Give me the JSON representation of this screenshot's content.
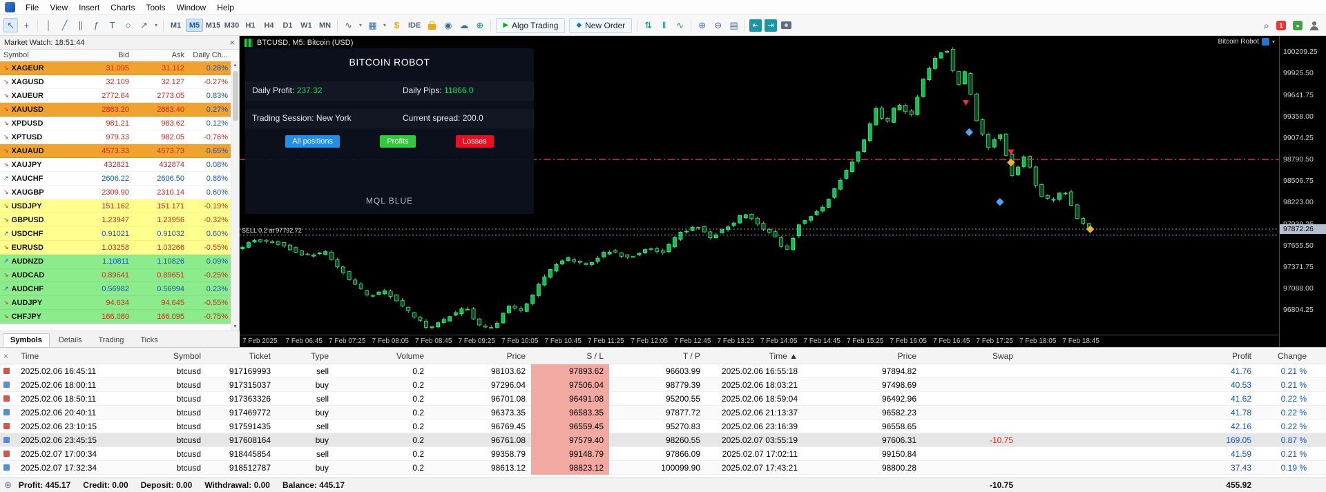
{
  "menu": {
    "items": [
      "File",
      "View",
      "Insert",
      "Charts",
      "Tools",
      "Window",
      "Help"
    ]
  },
  "toolbar": {
    "timeframes": [
      "M1",
      "M5",
      "M15",
      "M30",
      "H1",
      "H4",
      "D1",
      "W1",
      "MN"
    ],
    "active_timeframe": "M5",
    "algo_trading": "Algo Trading",
    "new_order": "New Order",
    "ide": "IDE",
    "notification_count": "1"
  },
  "icons": {
    "close": "×",
    "dropdown": "▾",
    "scroll_up": "▲",
    "scroll_down": "▼",
    "sort_asc": "▲",
    "pointer": "↖",
    "crosshair": "+",
    "vline": "│",
    "trendline": "╱",
    "channel": "∥",
    "fibonacci": "ƒ",
    "text_tool": "T",
    "shapes": "○",
    "arrow_tool": "↗",
    "indicators": "∿",
    "template": "▦",
    "dollar": "$",
    "signal": "◉",
    "cloud": "☁",
    "community": "⊕",
    "play": "▶",
    "order_plus": "◆",
    "sort": "⇅",
    "pause": "‖",
    "wave": "∿",
    "zoom_in": "⊕",
    "zoom_out": "⊖",
    "grid": "▤",
    "dock_left": "⇤",
    "dock_right": "⇥",
    "search": "⌕",
    "status_globe": "⊕",
    "vps_check": "●"
  },
  "market_watch": {
    "title": "Market Watch: 18:51:44",
    "columns": [
      "Symbol",
      "Bid",
      "Ask",
      "Daily Ch..."
    ],
    "tabs": [
      "Symbols",
      "Details",
      "Trading",
      "Ticks"
    ],
    "active_tab": "Symbols",
    "rows": [
      {
        "symbol": "XAGEUR",
        "bid": "31.095",
        "ask": "31.112",
        "change": "0.28%",
        "bg": "orange",
        "tick": "down"
      },
      {
        "symbol": "XAGUSD",
        "bid": "32.109",
        "ask": "32.127",
        "change": "-0.27%",
        "bg": "none",
        "tick": "down"
      },
      {
        "symbol": "XAUEUR",
        "bid": "2772.64",
        "ask": "2773.05",
        "change": "0.83%",
        "bg": "none",
        "tick": "down"
      },
      {
        "symbol": "XAUUSD",
        "bid": "2863.20",
        "ask": "2863.40",
        "change": "0.27%",
        "bg": "orange",
        "tick": "down"
      },
      {
        "symbol": "XPDUSD",
        "bid": "981.21",
        "ask": "983.62",
        "change": "0.12%",
        "bg": "none",
        "tick": "down"
      },
      {
        "symbol": "XPTUSD",
        "bid": "979.33",
        "ask": "982.05",
        "change": "-0.76%",
        "bg": "none",
        "tick": "down"
      },
      {
        "symbol": "XAUAUD",
        "bid": "4573.33",
        "ask": "4573.73",
        "change": "0.65%",
        "bg": "orange",
        "tick": "down"
      },
      {
        "symbol": "XAUJPY",
        "bid": "432821",
        "ask": "432874",
        "change": "0.08%",
        "bg": "none",
        "tick": "down"
      },
      {
        "symbol": "XAUCHF",
        "bid": "2606.22",
        "ask": "2606.50",
        "change": "0.88%",
        "bg": "none",
        "tick": "up"
      },
      {
        "symbol": "XAUGBP",
        "bid": "2309.90",
        "ask": "2310.14",
        "change": "0.60%",
        "bg": "none",
        "tick": "down"
      },
      {
        "symbol": "USDJPY",
        "bid": "151.162",
        "ask": "151.171",
        "change": "-0.19%",
        "bg": "yellow",
        "tick": "down"
      },
      {
        "symbol": "GBPUSD",
        "bid": "1.23947",
        "ask": "1.23956",
        "change": "-0.32%",
        "bg": "yellow",
        "tick": "down"
      },
      {
        "symbol": "USDCHF",
        "bid": "0.91021",
        "ask": "0.91032",
        "change": "0.60%",
        "bg": "yellow",
        "tick": "up"
      },
      {
        "symbol": "EURUSD",
        "bid": "1.03258",
        "ask": "1.03266",
        "change": "-0.55%",
        "bg": "yellow",
        "tick": "down"
      },
      {
        "symbol": "AUDNZD",
        "bid": "1.10811",
        "ask": "1.10826",
        "change": "0.09%",
        "bg": "green",
        "tick": "up"
      },
      {
        "symbol": "AUDCAD",
        "bid": "0.89641",
        "ask": "0.89651",
        "change": "-0.25%",
        "bg": "green",
        "tick": "down"
      },
      {
        "symbol": "AUDCHF",
        "bid": "0.56982",
        "ask": "0.56994",
        "change": "0.23%",
        "bg": "green",
        "tick": "up"
      },
      {
        "symbol": "AUDJPY",
        "bid": "94.634",
        "ask": "94.645",
        "change": "-0.55%",
        "bg": "green",
        "tick": "down"
      },
      {
        "symbol": "CHFJPY",
        "bid": "166.080",
        "ask": "166.095",
        "change": "-0.75%",
        "bg": "green",
        "tick": "down"
      }
    ]
  },
  "chart": {
    "title": "BTCUSD, M5: Bitcoin (USD)",
    "ea_label": "Bitcoin Robot",
    "sell_label": "SELL 0.2 at 97792.72",
    "current_price": "97872.26"
  },
  "robot_panel": {
    "title": "BITCOIN ROBOT",
    "daily_profit_label": "Daily Profit:",
    "daily_profit_value": "237.32",
    "daily_pips_label": "Daily Pips:",
    "daily_pips_value": "11866.0",
    "session_text": "Trading Session: New York",
    "spread_text": "Current spread: 200.0",
    "buttons": [
      {
        "label": "All positions",
        "color": "#1f8fe8"
      },
      {
        "label": "Profits",
        "color": "#2ecc3a"
      },
      {
        "label": "Losses",
        "color": "#e81123"
      }
    ],
    "footer": "MQL BLUE"
  },
  "chart_data": {
    "type": "candlestick",
    "symbol": "BTCUSD",
    "timeframe": "M5",
    "ylim": [
      96480,
      100420
    ],
    "candles": 144,
    "data_width_frac": 0.82,
    "y_ticks": [
      "100209.25",
      "99925.50",
      "99641.75",
      "99358.00",
      "99074.25",
      "98790.50",
      "98506.75",
      "98223.00",
      "97939.25",
      "97655.50",
      "97371.75",
      "97088.00",
      "96804.25"
    ],
    "x_labels": [
      "7 Feb 2025",
      "7 Feb 06:45",
      "7 Feb 07:25",
      "7 Feb 08:05",
      "7 Feb 08:45",
      "7 Feb 09:25",
      "7 Feb 10:05",
      "7 Feb 10:45",
      "7 Feb 11:25",
      "7 Feb 12:05",
      "7 Feb 12:45",
      "7 Feb 13:25",
      "7 Feb 14:05",
      "7 Feb 14:45",
      "7 Feb 15:25",
      "7 Feb 16:05",
      "7 Feb 16:45",
      "7 Feb 17:25",
      "7 Feb 18:05",
      "7 Feb 18:45"
    ],
    "current_price": 97872.26,
    "price_path": [
      [
        0,
        97600
      ],
      [
        0.02,
        97730
      ],
      [
        0.05,
        97680
      ],
      [
        0.08,
        97520
      ],
      [
        0.105,
        97560
      ],
      [
        0.13,
        97230
      ],
      [
        0.155,
        96980
      ],
      [
        0.175,
        97060
      ],
      [
        0.2,
        96800
      ],
      [
        0.225,
        96560
      ],
      [
        0.25,
        96720
      ],
      [
        0.268,
        96850
      ],
      [
        0.285,
        96590
      ],
      [
        0.302,
        96570
      ],
      [
        0.318,
        96860
      ],
      [
        0.335,
        96790
      ],
      [
        0.36,
        97240
      ],
      [
        0.385,
        97500
      ],
      [
        0.41,
        97390
      ],
      [
        0.435,
        97590
      ],
      [
        0.46,
        97490
      ],
      [
        0.48,
        97620
      ],
      [
        0.5,
        97560
      ],
      [
        0.52,
        97830
      ],
      [
        0.54,
        97910
      ],
      [
        0.555,
        97760
      ],
      [
        0.575,
        97890
      ],
      [
        0.595,
        98080
      ],
      [
        0.61,
        97950
      ],
      [
        0.63,
        97790
      ],
      [
        0.645,
        97570
      ],
      [
        0.66,
        97950
      ],
      [
        0.675,
        98060
      ],
      [
        0.69,
        98190
      ],
      [
        0.705,
        98480
      ],
      [
        0.72,
        98720
      ],
      [
        0.735,
        99010
      ],
      [
        0.75,
        99460
      ],
      [
        0.762,
        99240
      ],
      [
        0.775,
        99560
      ],
      [
        0.79,
        99340
      ],
      [
        0.805,
        99830
      ],
      [
        0.822,
        100190
      ],
      [
        0.835,
        100240
      ],
      [
        0.845,
        99720
      ],
      [
        0.855,
        99960
      ],
      [
        0.868,
        99320
      ],
      [
        0.882,
        98940
      ],
      [
        0.895,
        99160
      ],
      [
        0.91,
        98560
      ],
      [
        0.925,
        98870
      ],
      [
        0.94,
        98360
      ],
      [
        0.955,
        98230
      ],
      [
        0.97,
        98420
      ],
      [
        0.985,
        98030
      ],
      [
        1,
        97872
      ]
    ],
    "levels": [
      {
        "name": "resistance",
        "price": 98790.5,
        "color": "#ff2a2a",
        "dash": "10 4 2 4",
        "width": 1.4
      },
      {
        "name": "current-price",
        "price": 97872.26,
        "color": "#93a1b0",
        "dash": "2 3",
        "width": 1
      },
      {
        "name": "sell-entry",
        "price": 97792.72,
        "color": "#7fb2e5",
        "dash": "2 3",
        "width": 1
      }
    ],
    "markers": [
      {
        "t": 0.852,
        "p": 99500,
        "type": "arrow-down",
        "color": "#ff2a2a"
      },
      {
        "t": 0.856,
        "p": 99150,
        "type": "diamond",
        "color": "#4da3ff"
      },
      {
        "t": 0.905,
        "p": 98850,
        "type": "arrow-down",
        "color": "#ff2a2a"
      },
      {
        "t": 0.905,
        "p": 98750,
        "type": "diamond",
        "color": "#ffb020"
      },
      {
        "t": 0.892,
        "p": 98230,
        "type": "diamond",
        "color": "#4da3ff"
      },
      {
        "t": 0.998,
        "p": 97870,
        "type": "diamond",
        "color": "#ffb020"
      }
    ],
    "colors": {
      "up_fill": "#0fbf53",
      "down_fill": "#0b4a20",
      "stroke": "#3dff8e"
    }
  },
  "history": {
    "columns": [
      {
        "label": "Time",
        "align": "left"
      },
      {
        "label": "Symbol",
        "align": "right"
      },
      {
        "label": "Ticket",
        "align": "right"
      },
      {
        "label": "Type",
        "align": "right"
      },
      {
        "label": "Volume",
        "align": "right"
      },
      {
        "label": "Price",
        "align": "right"
      },
      {
        "label": "S / L",
        "align": "right"
      },
      {
        "label": "T / P",
        "align": "right"
      },
      {
        "label": "Time",
        "align": "right",
        "sorted": "asc"
      },
      {
        "label": "Price",
        "align": "right"
      },
      {
        "label": "Swap",
        "align": "right"
      },
      {
        "label": "Profit",
        "align": "right"
      },
      {
        "label": "Change",
        "align": "right"
      }
    ],
    "rows": [
      {
        "time": "2025.02.06 16:45:11",
        "symbol": "btcusd",
        "ticket": "917169993",
        "type": "sell",
        "volume": "0.2",
        "price": "98103.62",
        "sl": "97893.62",
        "tp": "96603.99",
        "close_time": "2025.02.06 16:55:18",
        "close_price": "97894.82",
        "swap": "",
        "profit": "41.76",
        "change": "0.21 %"
      },
      {
        "time": "2025.02.06 18:00:11",
        "symbol": "btcusd",
        "ticket": "917315037",
        "type": "buy",
        "volume": "0.2",
        "price": "97296.04",
        "sl": "97506.04",
        "tp": "98779.39",
        "close_time": "2025.02.06 18:03:21",
        "close_price": "97498.69",
        "swap": "",
        "profit": "40.53",
        "change": "0.21 %"
      },
      {
        "time": "2025.02.06 18:50:11",
        "symbol": "btcusd",
        "ticket": "917363326",
        "type": "sell",
        "volume": "0.2",
        "price": "96701.08",
        "sl": "96491.08",
        "tp": "95200.55",
        "close_time": "2025.02.06 18:59:04",
        "close_price": "96492.96",
        "swap": "",
        "profit": "41.62",
        "change": "0.22 %"
      },
      {
        "time": "2025.02.06 20:40:11",
        "symbol": "btcusd",
        "ticket": "917469772",
        "type": "buy",
        "volume": "0.2",
        "price": "96373.35",
        "sl": "96583.35",
        "tp": "97877.72",
        "close_time": "2025.02.06 21:13:37",
        "close_price": "96582.23",
        "swap": "",
        "profit": "41.78",
        "change": "0.22 %"
      },
      {
        "time": "2025.02.06 23:10:15",
        "symbol": "btcusd",
        "ticket": "917591435",
        "type": "sell",
        "volume": "0.2",
        "price": "96769.45",
        "sl": "96559.45",
        "tp": "95270.83",
        "close_time": "2025.02.06 23:16:39",
        "close_price": "96558.65",
        "swap": "",
        "profit": "42.16",
        "change": "0.22 %"
      },
      {
        "time": "2025.02.06 23:45:15",
        "symbol": "btcusd",
        "ticket": "917608164",
        "type": "buy",
        "volume": "0.2",
        "price": "96761.08",
        "sl": "97579.40",
        "tp": "98260.55",
        "close_time": "2025.02.07 03:55:19",
        "close_price": "97606.31",
        "swap": "-10.75",
        "profit": "169.05",
        "change": "0.87 %"
      },
      {
        "time": "2025.02.07 17:00:34",
        "symbol": "btcusd",
        "ticket": "918445854",
        "type": "sell",
        "volume": "0.2",
        "price": "99358.79",
        "sl": "99148.79",
        "tp": "97866.09",
        "close_time": "2025.02.07 17:02:11",
        "close_price": "99150.84",
        "swap": "",
        "profit": "41.59",
        "change": "0.21 %"
      },
      {
        "time": "2025.02.07 17:32:34",
        "symbol": "btcusd",
        "ticket": "918512787",
        "type": "buy",
        "volume": "0.2",
        "price": "98613.12",
        "sl": "98823.12",
        "tp": "100099.90",
        "close_time": "2025.02.07 17:43:21",
        "close_price": "98800.28",
        "swap": "",
        "profit": "37.43",
        "change": "0.19 %"
      }
    ]
  },
  "status_bar": {
    "items": [
      "Profit: 445.17",
      "Credit: 0.00",
      "Deposit: 0.00",
      "Withdrawal: 0.00",
      "Balance: 445.17"
    ],
    "swap_total": "-10.75",
    "profit_total": "455.92"
  }
}
